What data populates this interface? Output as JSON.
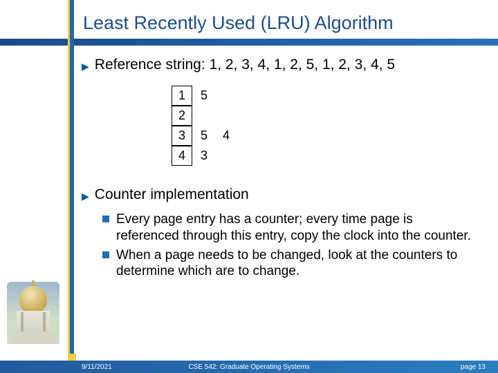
{
  "title": "Least Recently Used (LRU) Algorithm",
  "reference_string_label": "Reference string:  1, 2, 3, 4, 1, 2, 5, 1, 2, 3, 4, 5",
  "frames": {
    "row1": {
      "cell": "1",
      "aux": [
        "5"
      ]
    },
    "row2": {
      "cell": "2",
      "aux": []
    },
    "row3": {
      "cell": "3",
      "aux": [
        "5",
        "4"
      ]
    },
    "row4": {
      "cell": "4",
      "aux": [
        "3"
      ]
    }
  },
  "counter_heading": "Counter implementation",
  "sub_bullets": [
    "Every page entry has a counter; every time page is referenced through this entry, copy the clock into the counter.",
    "When a page needs to be changed, look at the counters to determine which are to change."
  ],
  "footer": {
    "date": "9/11/2021",
    "course": "CSE 542: Graduate Operating Systems",
    "page": "page 13"
  }
}
